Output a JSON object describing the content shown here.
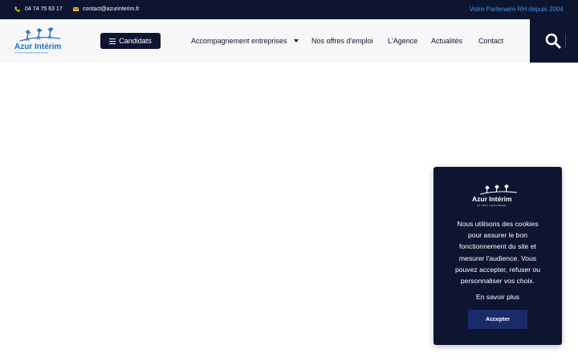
{
  "topbar": {
    "phone": "04 74 75 63 17",
    "email": "contact@azurinterim.fr",
    "tagline": "Votre Partenaire RH depuis 2004"
  },
  "logo": {
    "name": "Azur Intérim",
    "slogan": "Le travail temporaire proche de vous",
    "icon": "jumping-figures-logo"
  },
  "nav": {
    "candidats": "Candidats",
    "accompagnement": "Accompagnement entreprises",
    "offres": "Nos offres d'emploi",
    "agence": "L'Agence",
    "actualites": "Actualités",
    "contact": "Contact"
  },
  "cookie": {
    "logo_name": "Azur Intérim",
    "logo_slogan": "RH • Intérim • Agence Marseille",
    "text": "Nous utilisons des cookies pour assurer le bon fonctionnement du site et mesurer l'audience. Vous pouvez accepter, refuser ou personnaliser vos choix.",
    "more": "En savoir plus",
    "accept": "Accepter"
  },
  "colors": {
    "navy": "#0d1530",
    "accent_blue": "#4a90e2",
    "icon_yellow": "#f3c623",
    "button_blue": "#1b2a6b"
  }
}
